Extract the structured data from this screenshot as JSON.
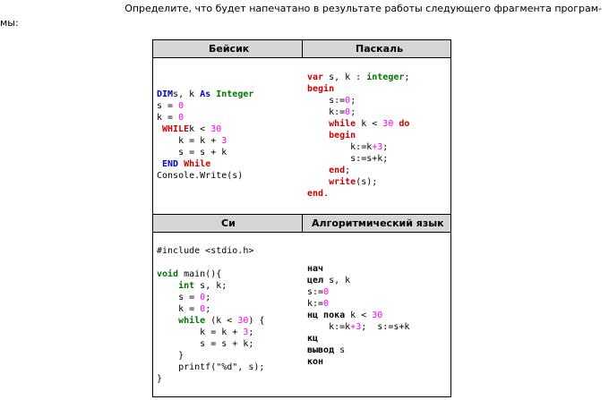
{
  "question": {
    "line1": "Определите, что будет напечатано в результате работы следующего фрагмента програм-",
    "line2": "мы:"
  },
  "headers": {
    "basic": "Бейсик",
    "pascal": "Паскаль",
    "c": "Си",
    "algo": "Алгоритмический язык"
  },
  "code": {
    "basic": [
      [
        [
          "kw-b",
          "DIM"
        ],
        [
          "",
          "s, k "
        ],
        [
          "kw-b",
          "As"
        ],
        [
          "",
          ""
        ],
        [
          "kw-g",
          " Integer"
        ]
      ],
      [
        [
          "",
          "s = "
        ],
        [
          "num",
          "0"
        ]
      ],
      [
        [
          "",
          "k = "
        ],
        [
          "num",
          "0"
        ]
      ],
      [
        [
          "kw-r",
          " WHILE"
        ],
        [
          "",
          ""
        ],
        [
          "",
          "k < "
        ],
        [
          "num",
          "30"
        ]
      ],
      [
        [
          "",
          "    k = k + "
        ],
        [
          "num",
          "3"
        ]
      ],
      [
        [
          "",
          "    s = s + k"
        ]
      ],
      [
        [
          "kw-b",
          " END"
        ],
        [
          "kw-r",
          " While"
        ]
      ],
      [
        [
          "",
          "Console.Write(s)"
        ]
      ]
    ],
    "pascal": [
      [
        [
          "kw-r",
          "var"
        ],
        [
          "",
          " s, k : "
        ],
        [
          "kw-g",
          "integer"
        ],
        [
          "",
          ";"
        ]
      ],
      [
        [
          "kw-r",
          "begin"
        ]
      ],
      [
        [
          "",
          "    s:="
        ],
        [
          "num",
          "0"
        ],
        [
          "",
          ";"
        ]
      ],
      [
        [
          "",
          "    k:="
        ],
        [
          "num",
          "0"
        ],
        [
          "",
          ";"
        ]
      ],
      [
        [
          "kw-r",
          "    while"
        ],
        [
          "",
          " k < "
        ],
        [
          "num",
          "30"
        ],
        [
          "kw-r",
          " do"
        ]
      ],
      [
        [
          "kw-r",
          "    begin"
        ]
      ],
      [
        [
          "",
          "        k:=k"
        ],
        [
          "num",
          "+3"
        ],
        [
          "",
          ";"
        ]
      ],
      [
        [
          "",
          "        s:=s+k;"
        ]
      ],
      [
        [
          "kw-r",
          "    end"
        ],
        [
          "",
          ";"
        ]
      ],
      [
        [
          "kw-r",
          "    write"
        ],
        [
          "",
          "(s);"
        ]
      ],
      [
        [
          "kw-r",
          "end"
        ],
        [
          "",
          "."
        ]
      ]
    ],
    "c": [
      [
        [
          "",
          "#include <stdio.h>"
        ]
      ],
      [
        [
          "",
          ""
        ]
      ],
      [
        [
          "kw-g",
          "void"
        ],
        [
          "",
          " main(){"
        ]
      ],
      [
        [
          "kw-g",
          "    int"
        ],
        [
          "",
          " s, k;"
        ]
      ],
      [
        [
          "",
          "    s = "
        ],
        [
          "num",
          "0"
        ],
        [
          "",
          ";"
        ]
      ],
      [
        [
          "",
          "    k = "
        ],
        [
          "num",
          "0"
        ],
        [
          "",
          ";"
        ]
      ],
      [
        [
          "kw-g",
          "    while"
        ],
        [
          "",
          " (k < "
        ],
        [
          "num",
          "30"
        ],
        [
          "",
          ") {"
        ]
      ],
      [
        [
          "",
          "        k = k + "
        ],
        [
          "num",
          "3"
        ],
        [
          "",
          ";"
        ]
      ],
      [
        [
          "",
          "        s = s + k;"
        ]
      ],
      [
        [
          "",
          "    }"
        ]
      ],
      [
        [
          "",
          "    printf(\"%d\", s);"
        ]
      ],
      [
        [
          "",
          "}"
        ]
      ]
    ],
    "algo": [
      [
        [
          "kw-k",
          "нач"
        ]
      ],
      [
        [
          "kw-k",
          "цел"
        ],
        [
          "",
          " s, k"
        ]
      ],
      [
        [
          "",
          "s:="
        ],
        [
          "num",
          "0"
        ]
      ],
      [
        [
          "",
          "k:="
        ],
        [
          "num",
          "0"
        ]
      ],
      [
        [
          "kw-k",
          "нц пока"
        ],
        [
          "",
          " k < "
        ],
        [
          "num",
          "30"
        ]
      ],
      [
        [
          "",
          "    k:=k"
        ],
        [
          "num",
          "+3"
        ],
        [
          "",
          ";  s:=s+k"
        ]
      ],
      [
        [
          "kw-k",
          "кц"
        ]
      ],
      [
        [
          "kw-k",
          "вывод"
        ],
        [
          "",
          " s"
        ]
      ],
      [
        [
          "kw-k",
          "кон"
        ]
      ]
    ]
  }
}
